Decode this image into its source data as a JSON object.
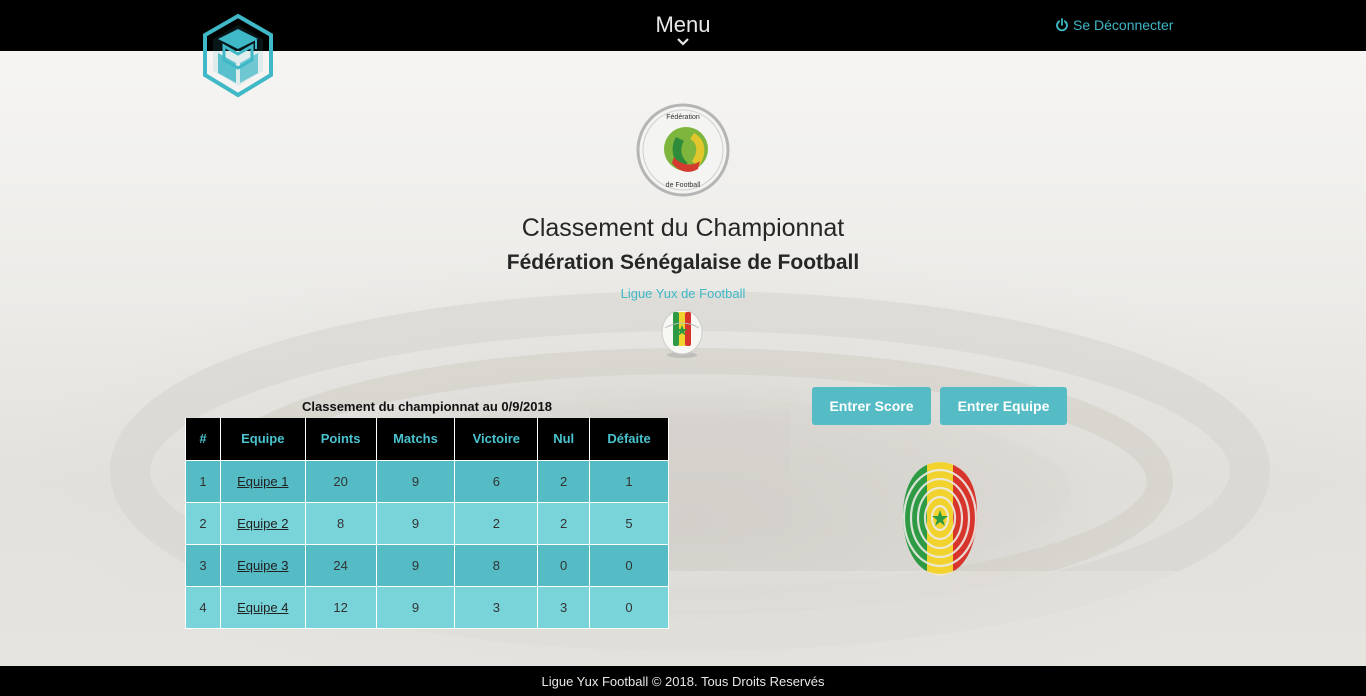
{
  "topbar": {
    "menu_label": "Menu",
    "logout_label": "Se Déconnecter"
  },
  "header": {
    "title": "Classement du Championnat",
    "subtitle": "Fédération Sénégalaise de Football",
    "league": "Ligue Yux de Football",
    "fsf_logo_text": "Fédération Sénégalaise de Football"
  },
  "table": {
    "caption": "Classement du championnat au 0/9/2018",
    "headers": [
      "#",
      "Equipe",
      "Points",
      "Matchs",
      "Victoire",
      "Nul",
      "Défaite"
    ],
    "rows": [
      {
        "rank": "1",
        "team": "Equipe 1",
        "points": "20",
        "matches": "9",
        "wins": "6",
        "draws": "2",
        "losses": "1"
      },
      {
        "rank": "2",
        "team": "Equipe 2",
        "points": "8",
        "matches": "9",
        "wins": "2",
        "draws": "2",
        "losses": "5"
      },
      {
        "rank": "3",
        "team": "Equipe 3",
        "points": "24",
        "matches": "9",
        "wins": "8",
        "draws": "0",
        "losses": "0"
      },
      {
        "rank": "4",
        "team": "Equipe 4",
        "points": "12",
        "matches": "9",
        "wins": "3",
        "draws": "3",
        "losses": "0"
      }
    ]
  },
  "actions": {
    "enter_score": "Entrer Score",
    "enter_team": "Entrer Equipe"
  },
  "footer": {
    "text": "Ligue Yux Football © 2018. Tous Droits Reservés"
  },
  "colors": {
    "accent": "#55bcc6",
    "accent_light": "#79d4da",
    "link": "#3fb8c7",
    "bar": "#000000"
  },
  "icons": {
    "logo": "cube-graduation-cap-logo",
    "menu": "chevron-down-icon",
    "logout": "power-icon",
    "ball": "senegal-ball-icon",
    "fingerprint": "senegal-fingerprint-icon"
  }
}
